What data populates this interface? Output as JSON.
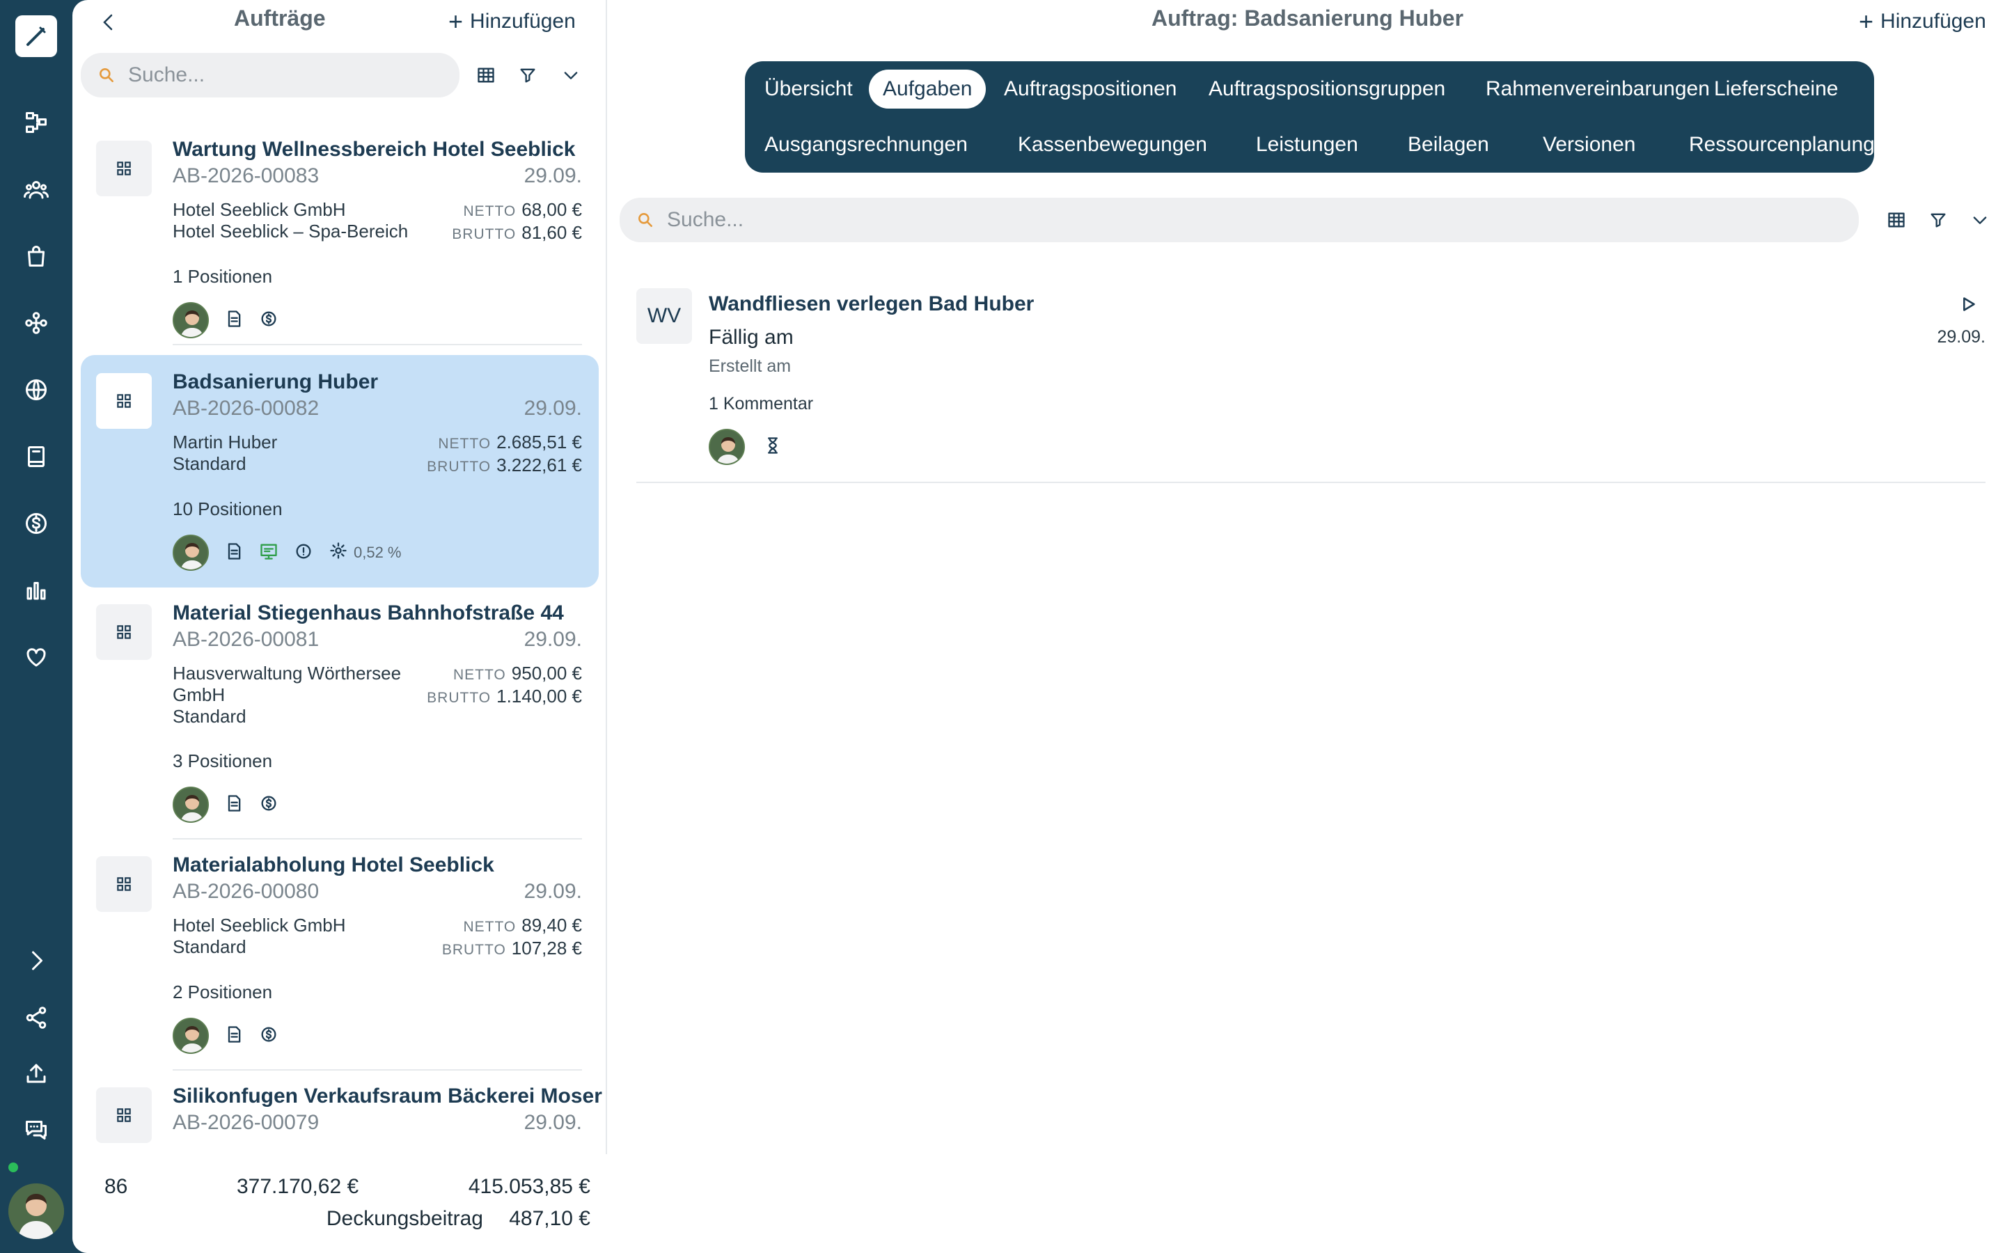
{
  "left_panel": {
    "title": "Aufträge",
    "add_label": "Hinzufügen",
    "search_placeholder": "Suche...",
    "orders": [
      {
        "title": "Wartung Wellnessbereich Hotel Seeblick",
        "number": "AB-2026-00083",
        "date": "29.09.",
        "customer_lines": [
          "Hotel Seeblick GmbH",
          "Hotel Seeblick – Spa-Bereich"
        ],
        "netto": "68,00 €",
        "brutto": "81,60 €",
        "positions": "1 Positionen"
      },
      {
        "title": "Badsanierung Huber",
        "number": "AB-2026-00082",
        "date": "29.09.",
        "customer_lines": [
          "Martin Huber",
          "Standard"
        ],
        "netto": "2.685,51 €",
        "brutto": "3.222,61 €",
        "positions": "10 Positionen",
        "margin_pct": "0,52 %",
        "selected": true
      },
      {
        "title": "Material Stiegenhaus Bahnhofstraße 44",
        "number": "AB-2026-00081",
        "date": "29.09.",
        "customer_lines": [
          "Hausverwaltung Wörthersee",
          "GmbH",
          "Standard"
        ],
        "netto": "950,00 €",
        "brutto": "1.140,00 €",
        "positions": "3 Positionen"
      },
      {
        "title": "Materialabholung Hotel Seeblick",
        "number": "AB-2026-00080",
        "date": "29.09.",
        "customer_lines": [
          "Hotel Seeblick GmbH",
          "Standard"
        ],
        "netto": "89,40 €",
        "brutto": "107,28 €",
        "positions": "2 Positionen"
      },
      {
        "title": "Silikonfugen Verkaufsraum Bäckerei Moser",
        "number": "AB-2026-00079",
        "date": "29.09."
      }
    ],
    "netto_label": "NETTO",
    "brutto_label": "BRUTTO",
    "summary": {
      "count": "86",
      "netto_total": "377.170,62 €",
      "brutto_total": "415.053,85 €",
      "db_label": "Deckungsbeitrag",
      "db_value": "487,10 €"
    }
  },
  "right_panel": {
    "title": "Auftrag: Badsanierung Huber",
    "add_label": "Hinzufügen",
    "search_placeholder": "Suche...",
    "tabs_row1": [
      "Übersicht",
      "Aufgaben",
      "Auftragspositionen",
      "Auftragspositionsgruppen",
      "Rahmenvereinbarungen",
      "Lieferscheine"
    ],
    "tabs_row2": [
      "Ausgangsrechnungen",
      "Kassenbewegungen",
      "Leistungen",
      "Beilagen",
      "Versionen",
      "Ressourcenplanung"
    ],
    "active_tab": "Aufgaben",
    "task": {
      "initials": "WV",
      "title": "Wandfliesen verlegen Bad Huber",
      "due_label": "Fällig am",
      "created_label": "Erstellt am",
      "comments": "1 Kommentar",
      "date": "29.09."
    }
  },
  "colors": {
    "sidebar": "#1a4258",
    "selected_card": "#c6e0f7",
    "accent_text": "#1d3b52",
    "online": "#2bbd5a"
  }
}
